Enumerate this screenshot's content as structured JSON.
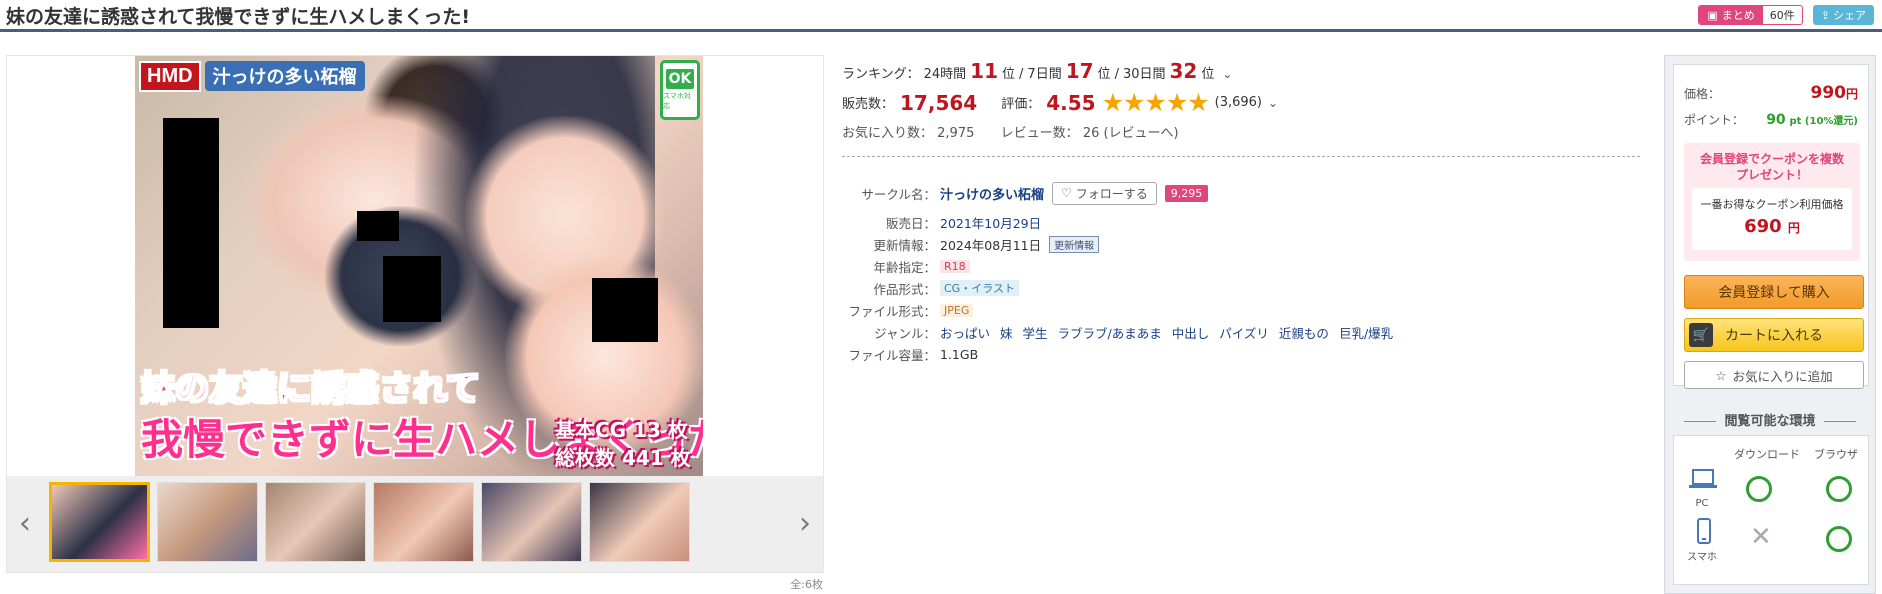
{
  "header": {
    "title": "妹の友達に誘惑されて我慢できずに生ハメしまくった!",
    "matome_label": "まとめ",
    "matome_count": "60件",
    "share_label": "シェア"
  },
  "gallery": {
    "logo_brand": "HMD",
    "logo_circle": "汁っけの多い柘榴",
    "ok_badge": "OK",
    "ok_badge_sub": "スマホ対応",
    "promo_line1": "妹の友達に誘惑されて",
    "promo_line2": "我慢できずに生ハメしまくった!",
    "promo_count1": "基本CG 13 枚",
    "promo_count2": "総枚数 441 枚",
    "total_count": "全:6枚",
    "prev_arrow": "‹",
    "next_arrow": "›"
  },
  "ranking": {
    "label": "ランキング：",
    "p24_label": "24時間",
    "p24_value": "11",
    "p7_label": "7日間",
    "p7_value": "17",
    "p30_label": "30日間",
    "p30_value": "32",
    "unit": "位",
    "sep": "/"
  },
  "sales": {
    "label": "販売数：",
    "value": "17,564",
    "rating_label": "評価：",
    "rating_value": "4.55",
    "stars": 4.55,
    "stars_glyphs": "★★★★★",
    "rating_count": "(3,696)"
  },
  "stats": {
    "favorites_label": "お気に入り数：",
    "favorites_value": "2,975",
    "reviews_label": "レビュー数：",
    "reviews_value": "26 (レビューへ)"
  },
  "spec": {
    "circle_label": "サークル名：",
    "circle_name": "汁っけの多い柘榴",
    "follow_label": "フォローする",
    "follow_count": "9,295",
    "release_label": "販売日：",
    "release_value": "2021年10月29日",
    "update_label": "更新情報：",
    "update_value": "2024年08月11日",
    "update_tag": "更新情報",
    "age_label": "年齢指定：",
    "age_value": "R18",
    "format_label": "作品形式：",
    "format_value": "CG・イラスト",
    "file_label": "ファイル形式：",
    "file_value": "JPEG",
    "genre_label": "ジャンル：",
    "genres": [
      "おっぱい",
      "妹",
      "学生",
      "ラブラブ/あまあま",
      "中出し",
      "パイズリ",
      "近親もの",
      "巨乳/爆乳"
    ],
    "size_label": "ファイル容量：",
    "size_value": "1.1GB"
  },
  "purchase": {
    "price_label": "価格：",
    "price_value": "990",
    "price_unit": "円",
    "point_label": "ポイント：",
    "point_value": "90",
    "point_unit": "pt (10%還元)",
    "coupon_title": "会員登録でクーポンを複数\nプレゼント！",
    "coupon_sub": "一番お得なクーポン利用価格",
    "coupon_price": "690",
    "coupon_unit": "円",
    "buy_button": "会員登録して購入",
    "cart_button": "カートに入れる",
    "fav_button": "お気に入りに追加"
  },
  "environment": {
    "title": "閲覧可能な環境",
    "col_download": "ダウンロード",
    "col_browser": "ブラウザ",
    "pc_label": "PC",
    "sp_label": "スマホ"
  },
  "colors": {
    "accent_red": "#c0151f",
    "pink": "#e0457b",
    "star": "#f5a400",
    "ok_green": "#2e9e2e"
  }
}
